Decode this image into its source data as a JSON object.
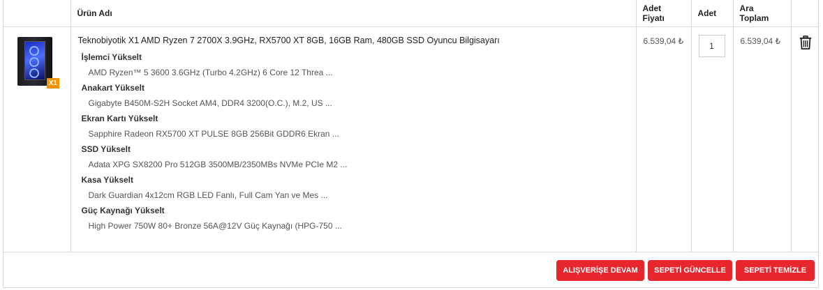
{
  "table": {
    "headers": {
      "product": "Ürün Adı",
      "unit_price": "Adet Fiyatı",
      "qty": "Adet",
      "subtotal": "Ara Toplam"
    }
  },
  "item": {
    "image_icon": "gaming-pc-image",
    "badge": "X1",
    "name": "Teknobiyotik X1 AMD Ryzen 7 2700X 3.9GHz, RX5700 XT 8GB, 16GB Ram, 480GB SSD Oyuncu Bilgisayarı",
    "options": [
      {
        "title": "İşlemci Yükselt",
        "value": "AMD Ryzen™ 5 3600 3.6GHz (Turbo 4.2GHz) 6 Core 12 Threa ..."
      },
      {
        "title": "Anakart Yükselt",
        "value": "Gigabyte B450M-S2H Socket AM4, DDR4 3200(O.C.), M.2, US ..."
      },
      {
        "title": "Ekran Kartı Yükselt",
        "value": "Sapphire Radeon RX5700 XT PULSE 8GB 256Bit GDDR6 Ekran ..."
      },
      {
        "title": "SSD Yükselt",
        "value": "Adata XPG SX8200 Pro 512GB 3500MB/2350MBs NVMe PCIe M2 ..."
      },
      {
        "title": "Kasa Yükselt",
        "value": "Dark Guardian 4x12cm RGB LED Fanlı, Full Cam Yan ve Mes ..."
      },
      {
        "title": "Güç Kaynağı Yükselt",
        "value": "High Power 750W 80+ Bronze 56A@12V Güç Kaynağı (HPG-750 ..."
      }
    ],
    "unit_price": "6.539,04 ₺",
    "qty": "1",
    "subtotal": "6.539,04 ₺",
    "delete_icon": "trash-icon"
  },
  "actions": {
    "continue": "ALIŞVERİŞE DEVAM",
    "update": "SEPETİ GÜNCELLE",
    "clear": "SEPETİ TEMİZLE"
  },
  "colors": {
    "accent": "#e8262d",
    "badge": "#f39100",
    "border": "#d9d9d9"
  }
}
